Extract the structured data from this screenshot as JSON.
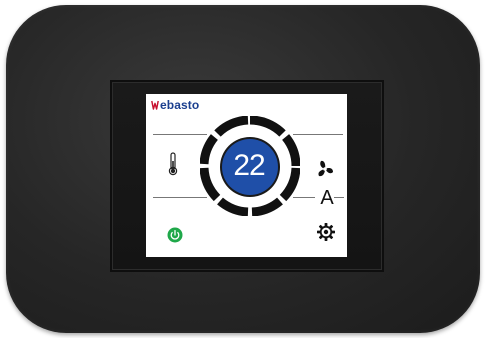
{
  "brand": {
    "name": "Webasto",
    "logo_mark": "W",
    "logo_rest": "ebasto",
    "color": "#1b3f8f"
  },
  "display": {
    "setpoint": "22",
    "setpoint_circle_color": "#1f4fa8",
    "ring_color": "#111111"
  },
  "controls": {
    "temperature_icon": "thermometer-icon",
    "fan_icon": "fan-icon",
    "mode_label": "A",
    "settings_icon": "gear-icon",
    "power_icon": "power-icon",
    "power_color": "#1fa84a"
  }
}
